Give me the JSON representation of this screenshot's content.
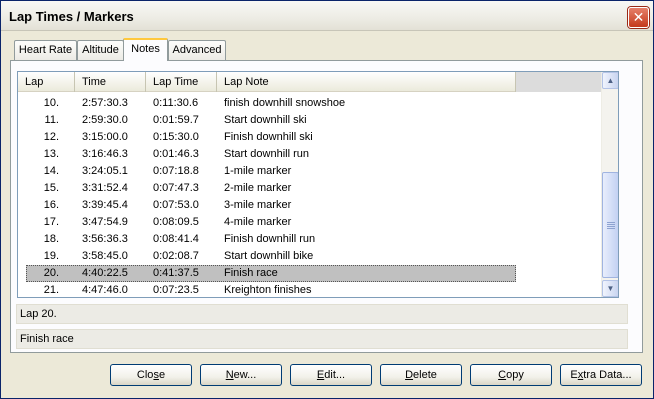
{
  "window": {
    "title": "Lap Times / Markers",
    "close_symbol": "✕"
  },
  "tabs": [
    {
      "label": "Heart Rate",
      "active": false
    },
    {
      "label": "Altitude",
      "active": false
    },
    {
      "label": "Notes",
      "active": true
    },
    {
      "label": "Advanced",
      "active": false
    }
  ],
  "list": {
    "columns": [
      "Lap",
      "Time",
      "Lap Time",
      "Lap Note"
    ],
    "rows": [
      {
        "lap": "10.",
        "time": "2:57:30.3",
        "lap_time": "0:11:30.6",
        "note": "finish downhill snowshoe"
      },
      {
        "lap": "11.",
        "time": "2:59:30.0",
        "lap_time": "0:01:59.7",
        "note": "Start downhill ski"
      },
      {
        "lap": "12.",
        "time": "3:15:00.0",
        "lap_time": "0:15:30.0",
        "note": "Finish downhill ski"
      },
      {
        "lap": "13.",
        "time": "3:16:46.3",
        "lap_time": "0:01:46.3",
        "note": "Start downhill run"
      },
      {
        "lap": "14.",
        "time": "3:24:05.1",
        "lap_time": "0:07:18.8",
        "note": "1-mile marker"
      },
      {
        "lap": "15.",
        "time": "3:31:52.4",
        "lap_time": "0:07:47.3",
        "note": "2-mile marker"
      },
      {
        "lap": "16.",
        "time": "3:39:45.4",
        "lap_time": "0:07:53.0",
        "note": "3-mile marker"
      },
      {
        "lap": "17.",
        "time": "3:47:54.9",
        "lap_time": "0:08:09.5",
        "note": "4-mile marker"
      },
      {
        "lap": "18.",
        "time": "3:56:36.3",
        "lap_time": "0:08:41.4",
        "note": "Finish downhill run"
      },
      {
        "lap": "19.",
        "time": "3:58:45.0",
        "lap_time": "0:02:08.7",
        "note": "Start downhill bike"
      },
      {
        "lap": "20.",
        "time": "4:40:22.5",
        "lap_time": "0:41:37.5",
        "note": "Finish race",
        "selected": true
      },
      {
        "lap": "21.",
        "time": "4:47:46.0",
        "lap_time": "0:07:23.5",
        "note": "Kreighton finishes"
      }
    ],
    "scroll_up_symbol": "▲",
    "scroll_down_symbol": "▼"
  },
  "details": {
    "lap_label": "Lap 20.",
    "note": "Finish race"
  },
  "buttons": [
    {
      "pre": "Clo",
      "u": "s",
      "post": "e"
    },
    {
      "pre": "",
      "u": "N",
      "post": "ew..."
    },
    {
      "pre": "",
      "u": "E",
      "post": "dit..."
    },
    {
      "pre": "",
      "u": "D",
      "post": "elete"
    },
    {
      "pre": "",
      "u": "C",
      "post": "opy"
    },
    {
      "pre": "E",
      "u": "x",
      "post": "tra Data..."
    }
  ]
}
